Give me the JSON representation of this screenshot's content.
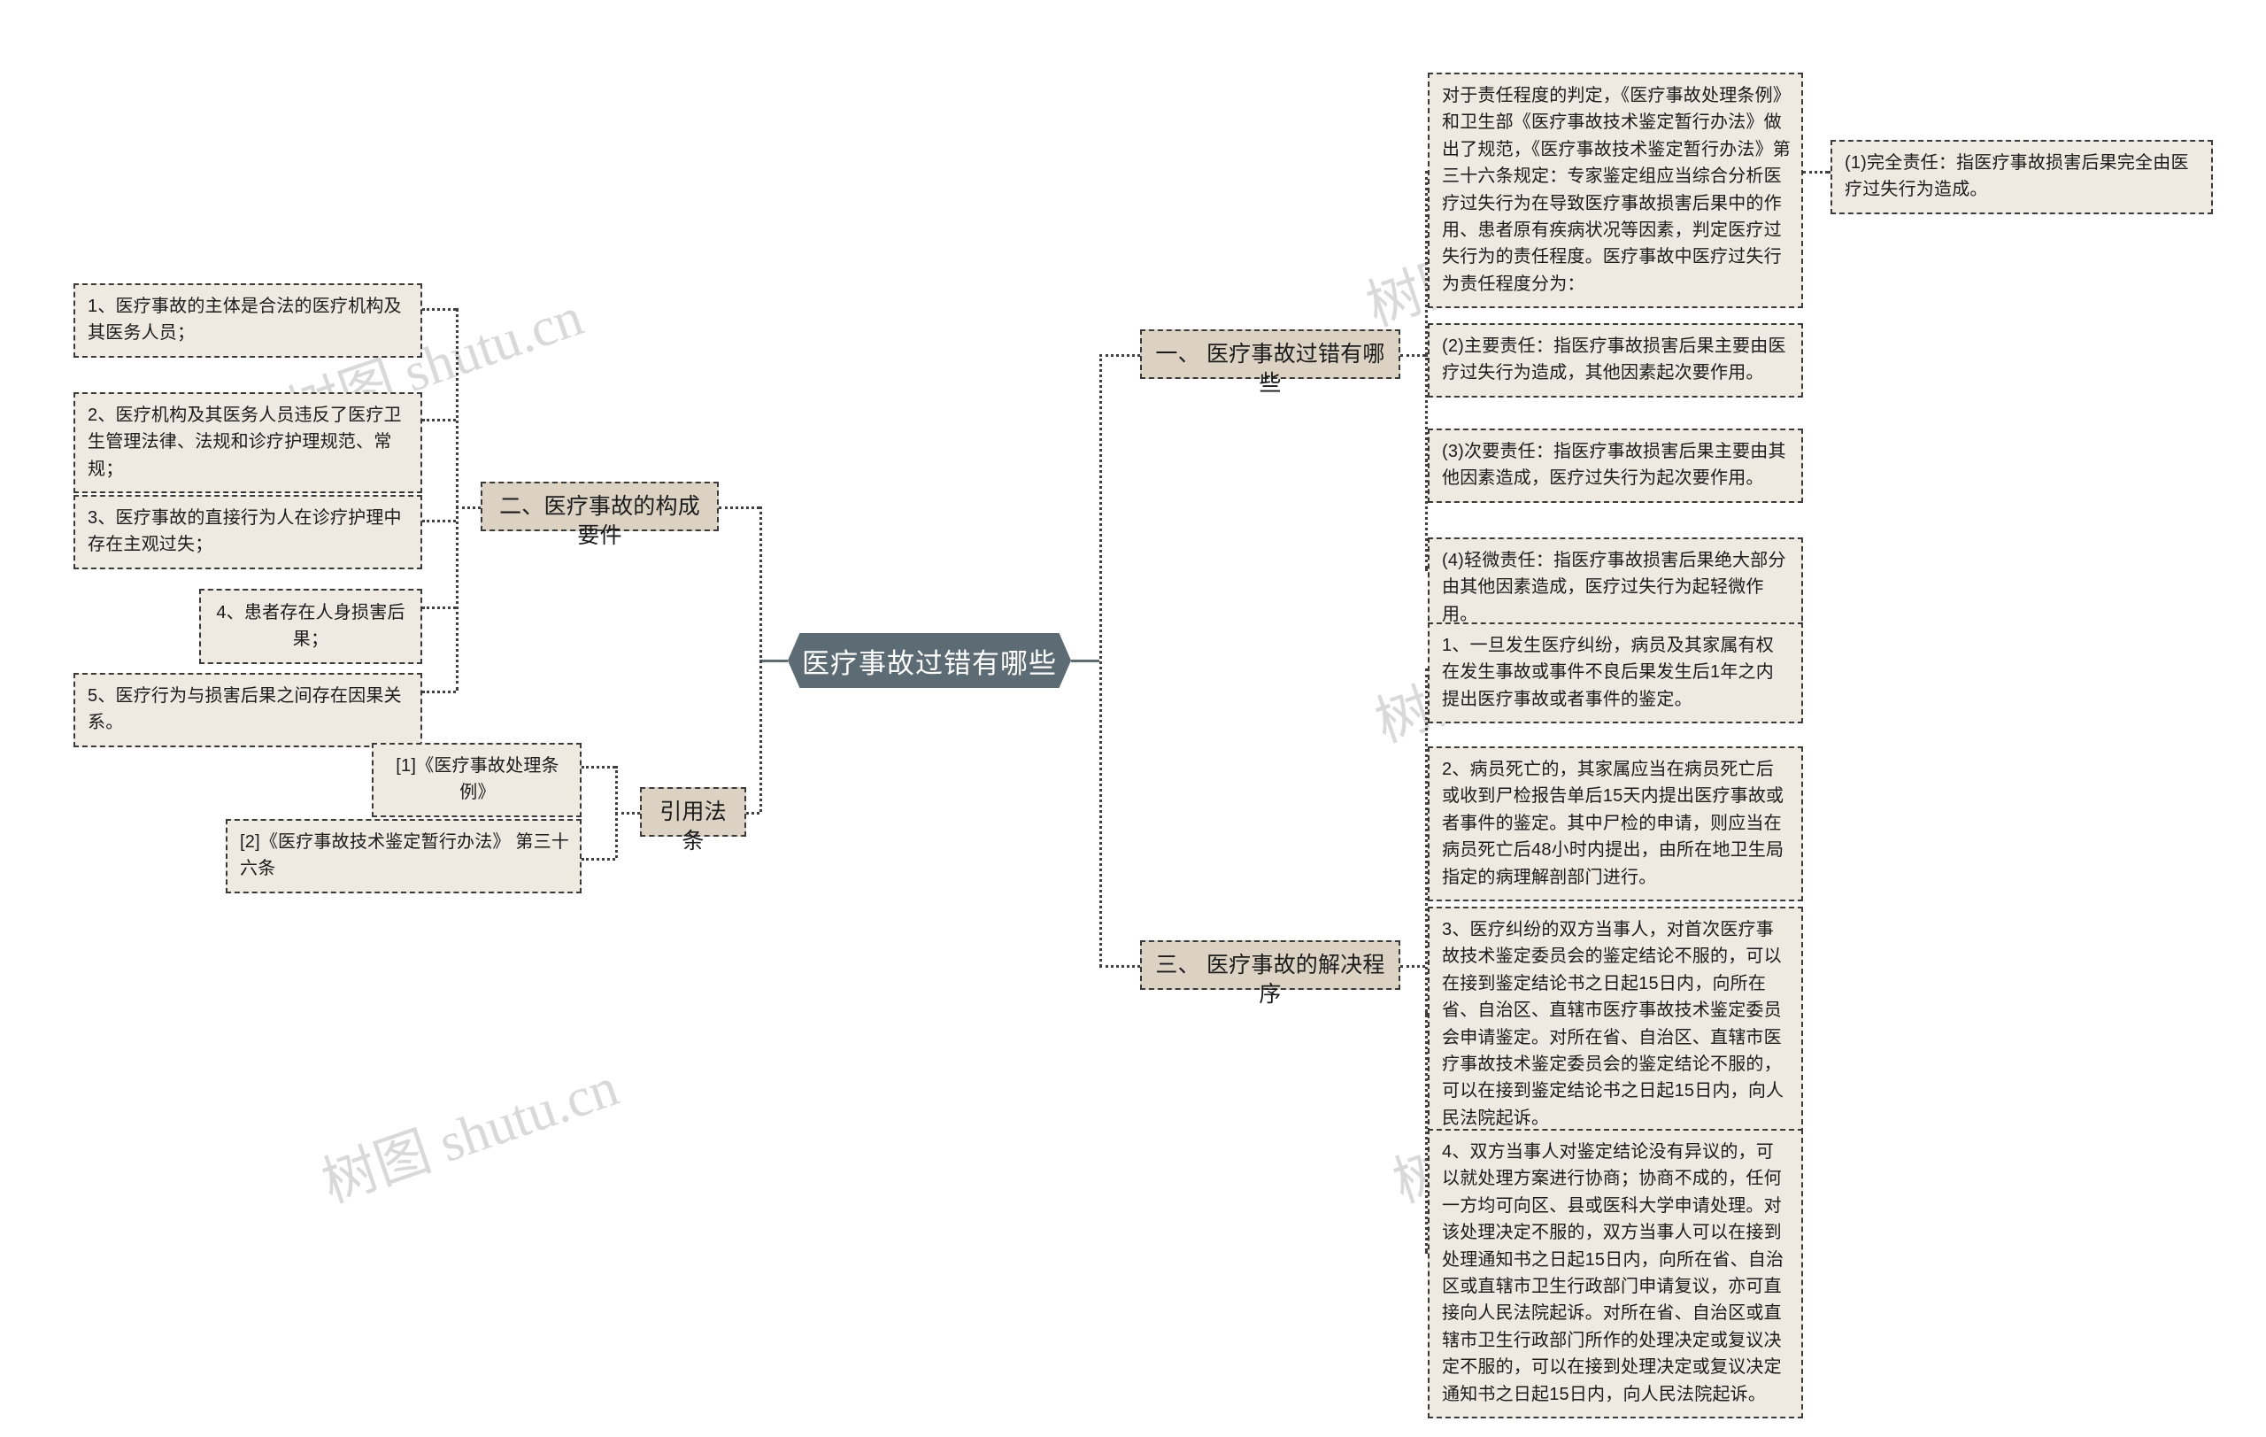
{
  "root": {
    "label": "医疗事故过错有哪些"
  },
  "watermark": {
    "text": "树图 shutu.cn"
  },
  "colors": {
    "root_bg": "#5c6b74",
    "heading_bg": "#dbd2c3",
    "body_bg": "#eeeae1",
    "border": "#3a3a3a",
    "connector": "#3f3f3f",
    "page_bg": "#ffffff",
    "watermark": "#d9d9d9"
  },
  "branches": {
    "b1": {
      "label": "一、 医疗事故过错有哪些",
      "children": [
        {
          "text": "对于责任程度的判定，《医疗事故处理条例》和卫生部《医疗事故技术鉴定暂行办法》做出了规范，《医疗事故技术鉴定暂行办法》第三十六条规定：专家鉴定组应当综合分析医疗过失行为在导致医疗事故损害后果中的作用、患者原有疾病状况等因素，判定医疗过失行为的责任程度。医疗事故中医疗过失行为责任程度分为：",
          "children": [
            {
              "text": "(1)完全责任：指医疗事故损害后果完全由医疗过失行为造成。"
            }
          ]
        },
        {
          "text": "(2)主要责任：指医疗事故损害后果主要由医疗过失行为造成，其他因素起次要作用。"
        },
        {
          "text": "(3)次要责任：指医疗事故损害后果主要由其他因素造成，医疗过失行为起次要作用。"
        },
        {
          "text": "(4)轻微责任：指医疗事故损害后果绝大部分由其他因素造成，医疗过失行为起轻微作用。"
        }
      ]
    },
    "b2": {
      "label": "二、医疗事故的构成要件",
      "children": [
        {
          "text": "1、医疗事故的主体是合法的医疗机构及其医务人员；"
        },
        {
          "text": "2、医疗机构及其医务人员违反了医疗卫生管理法律、法规和诊疗护理规范、常规；"
        },
        {
          "text": "3、医疗事故的直接行为人在诊疗护理中存在主观过失；"
        },
        {
          "text": "4、患者存在人身损害后果；"
        },
        {
          "text": "5、医疗行为与损害后果之间存在因果关系。"
        }
      ]
    },
    "b3": {
      "label": "三、 医疗事故的解决程序",
      "children": [
        {
          "text": "1、一旦发生医疗纠纷，病员及其家属有权在发生事故或事件不良后果发生后1年之内提出医疗事故或者事件的鉴定。"
        },
        {
          "text": "2、病员死亡的，其家属应当在病员死亡后或收到尸检报告单后15天内提出医疗事故或者事件的鉴定。其中尸检的申请，则应当在病员死亡后48小时内提出，由所在地卫生局指定的病理解剖部门进行。"
        },
        {
          "text": "3、医疗纠纷的双方当事人，对首次医疗事故技术鉴定委员会的鉴定结论不服的，可以在接到鉴定结论书之日起15日内，向所在省、自治区、直辖市医疗事故技术鉴定委员会申请鉴定。对所在省、自治区、直辖市医疗事故技术鉴定委员会的鉴定结论不服的，可以在接到鉴定结论书之日起15日内，向人民法院起诉。"
        },
        {
          "text": "4、双方当事人对鉴定结论没有异议的，可以就处理方案进行协商；协商不成的，任何一方均可向区、县或医科大学申请处理。对该处理决定不服的，双方当事人可以在接到处理通知书之日起15日内，向所在省、自治区或直辖市卫生行政部门申请复议，亦可直接向人民法院起诉。对所在省、自治区或直辖市卫生行政部门所作的处理决定或复议决定不服的，可以在接到处理决定或复议决定通知书之日起15日内，向人民法院起诉。"
        }
      ]
    },
    "b4": {
      "label": "引用法条",
      "children": [
        {
          "text": "[1]《医疗事故处理条例》"
        },
        {
          "text": "[2]《医疗事故技术鉴定暂行办法》 第三十六条"
        }
      ]
    }
  }
}
